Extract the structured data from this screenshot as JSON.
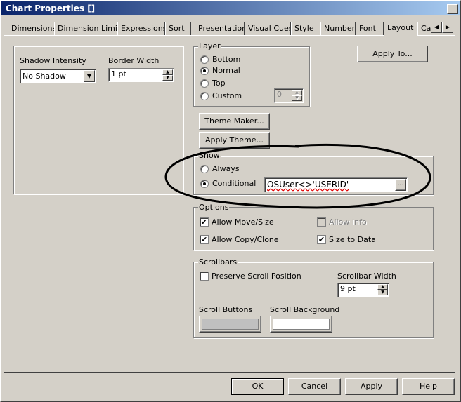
{
  "window": {
    "title": "Chart Properties []",
    "close_glyph": "×"
  },
  "tabs": [
    {
      "label": "Dimensions"
    },
    {
      "label": "Dimension Limits"
    },
    {
      "label": "Expressions"
    },
    {
      "label": "Sort"
    },
    {
      "label": "Presentation"
    },
    {
      "label": "Visual Cues"
    },
    {
      "label": "Style"
    },
    {
      "label": "Number"
    },
    {
      "label": "Font"
    },
    {
      "label": "Layout"
    },
    {
      "label": "Ca"
    }
  ],
  "active_tab": "Layout",
  "shadow": {
    "label": "Shadow Intensity",
    "value": "No Shadow"
  },
  "border": {
    "label": "Border Width",
    "value": "1 pt"
  },
  "layer": {
    "legend": "Layer",
    "options": [
      {
        "label": "Bottom",
        "checked": false
      },
      {
        "label": "Normal",
        "checked": true
      },
      {
        "label": "Top",
        "checked": false
      },
      {
        "label": "Custom",
        "checked": false
      }
    ],
    "custom_value": "0"
  },
  "buttons": {
    "apply_to": "Apply To...",
    "theme_maker": "Theme Maker...",
    "apply_theme": "Apply Theme...",
    "ok": "OK",
    "cancel": "Cancel",
    "apply": "Apply",
    "help": "Help",
    "ellipsis": "..."
  },
  "show": {
    "legend": "Show",
    "always_label": "Always",
    "always_checked": false,
    "conditional_label": "Conditional",
    "conditional_checked": true,
    "condition": "OSUser<>'USERID'"
  },
  "options": {
    "legend": "Options",
    "allow_move_size": {
      "label": "Allow Move/Size",
      "checked": true
    },
    "allow_copy_clone": {
      "label": "Allow Copy/Clone",
      "checked": true
    },
    "allow_info": {
      "label": "Allow Info",
      "checked": false,
      "disabled": true
    },
    "size_to_data": {
      "label": "Size to Data",
      "checked": true
    }
  },
  "scrollbars": {
    "legend": "Scrollbars",
    "preserve_label": "Preserve Scroll Position",
    "preserve_checked": false,
    "width_label": "Scrollbar Width",
    "width_value": "9 pt",
    "buttons_label": "Scroll Buttons",
    "background_label": "Scroll Background",
    "buttons_color": "#c0c0c0",
    "background_color": "#ffffff"
  },
  "icons": {
    "checkmark": "✔",
    "dropdown": "▼",
    "spin_up": "▲",
    "spin_down": "▼",
    "tab_left": "◀",
    "tab_right": "▶"
  },
  "colors": {
    "titlebar_start": "#0a246a",
    "titlebar_end": "#a6caf0",
    "face": "#d4d0c8",
    "annotation_ellipse": "#000000"
  }
}
